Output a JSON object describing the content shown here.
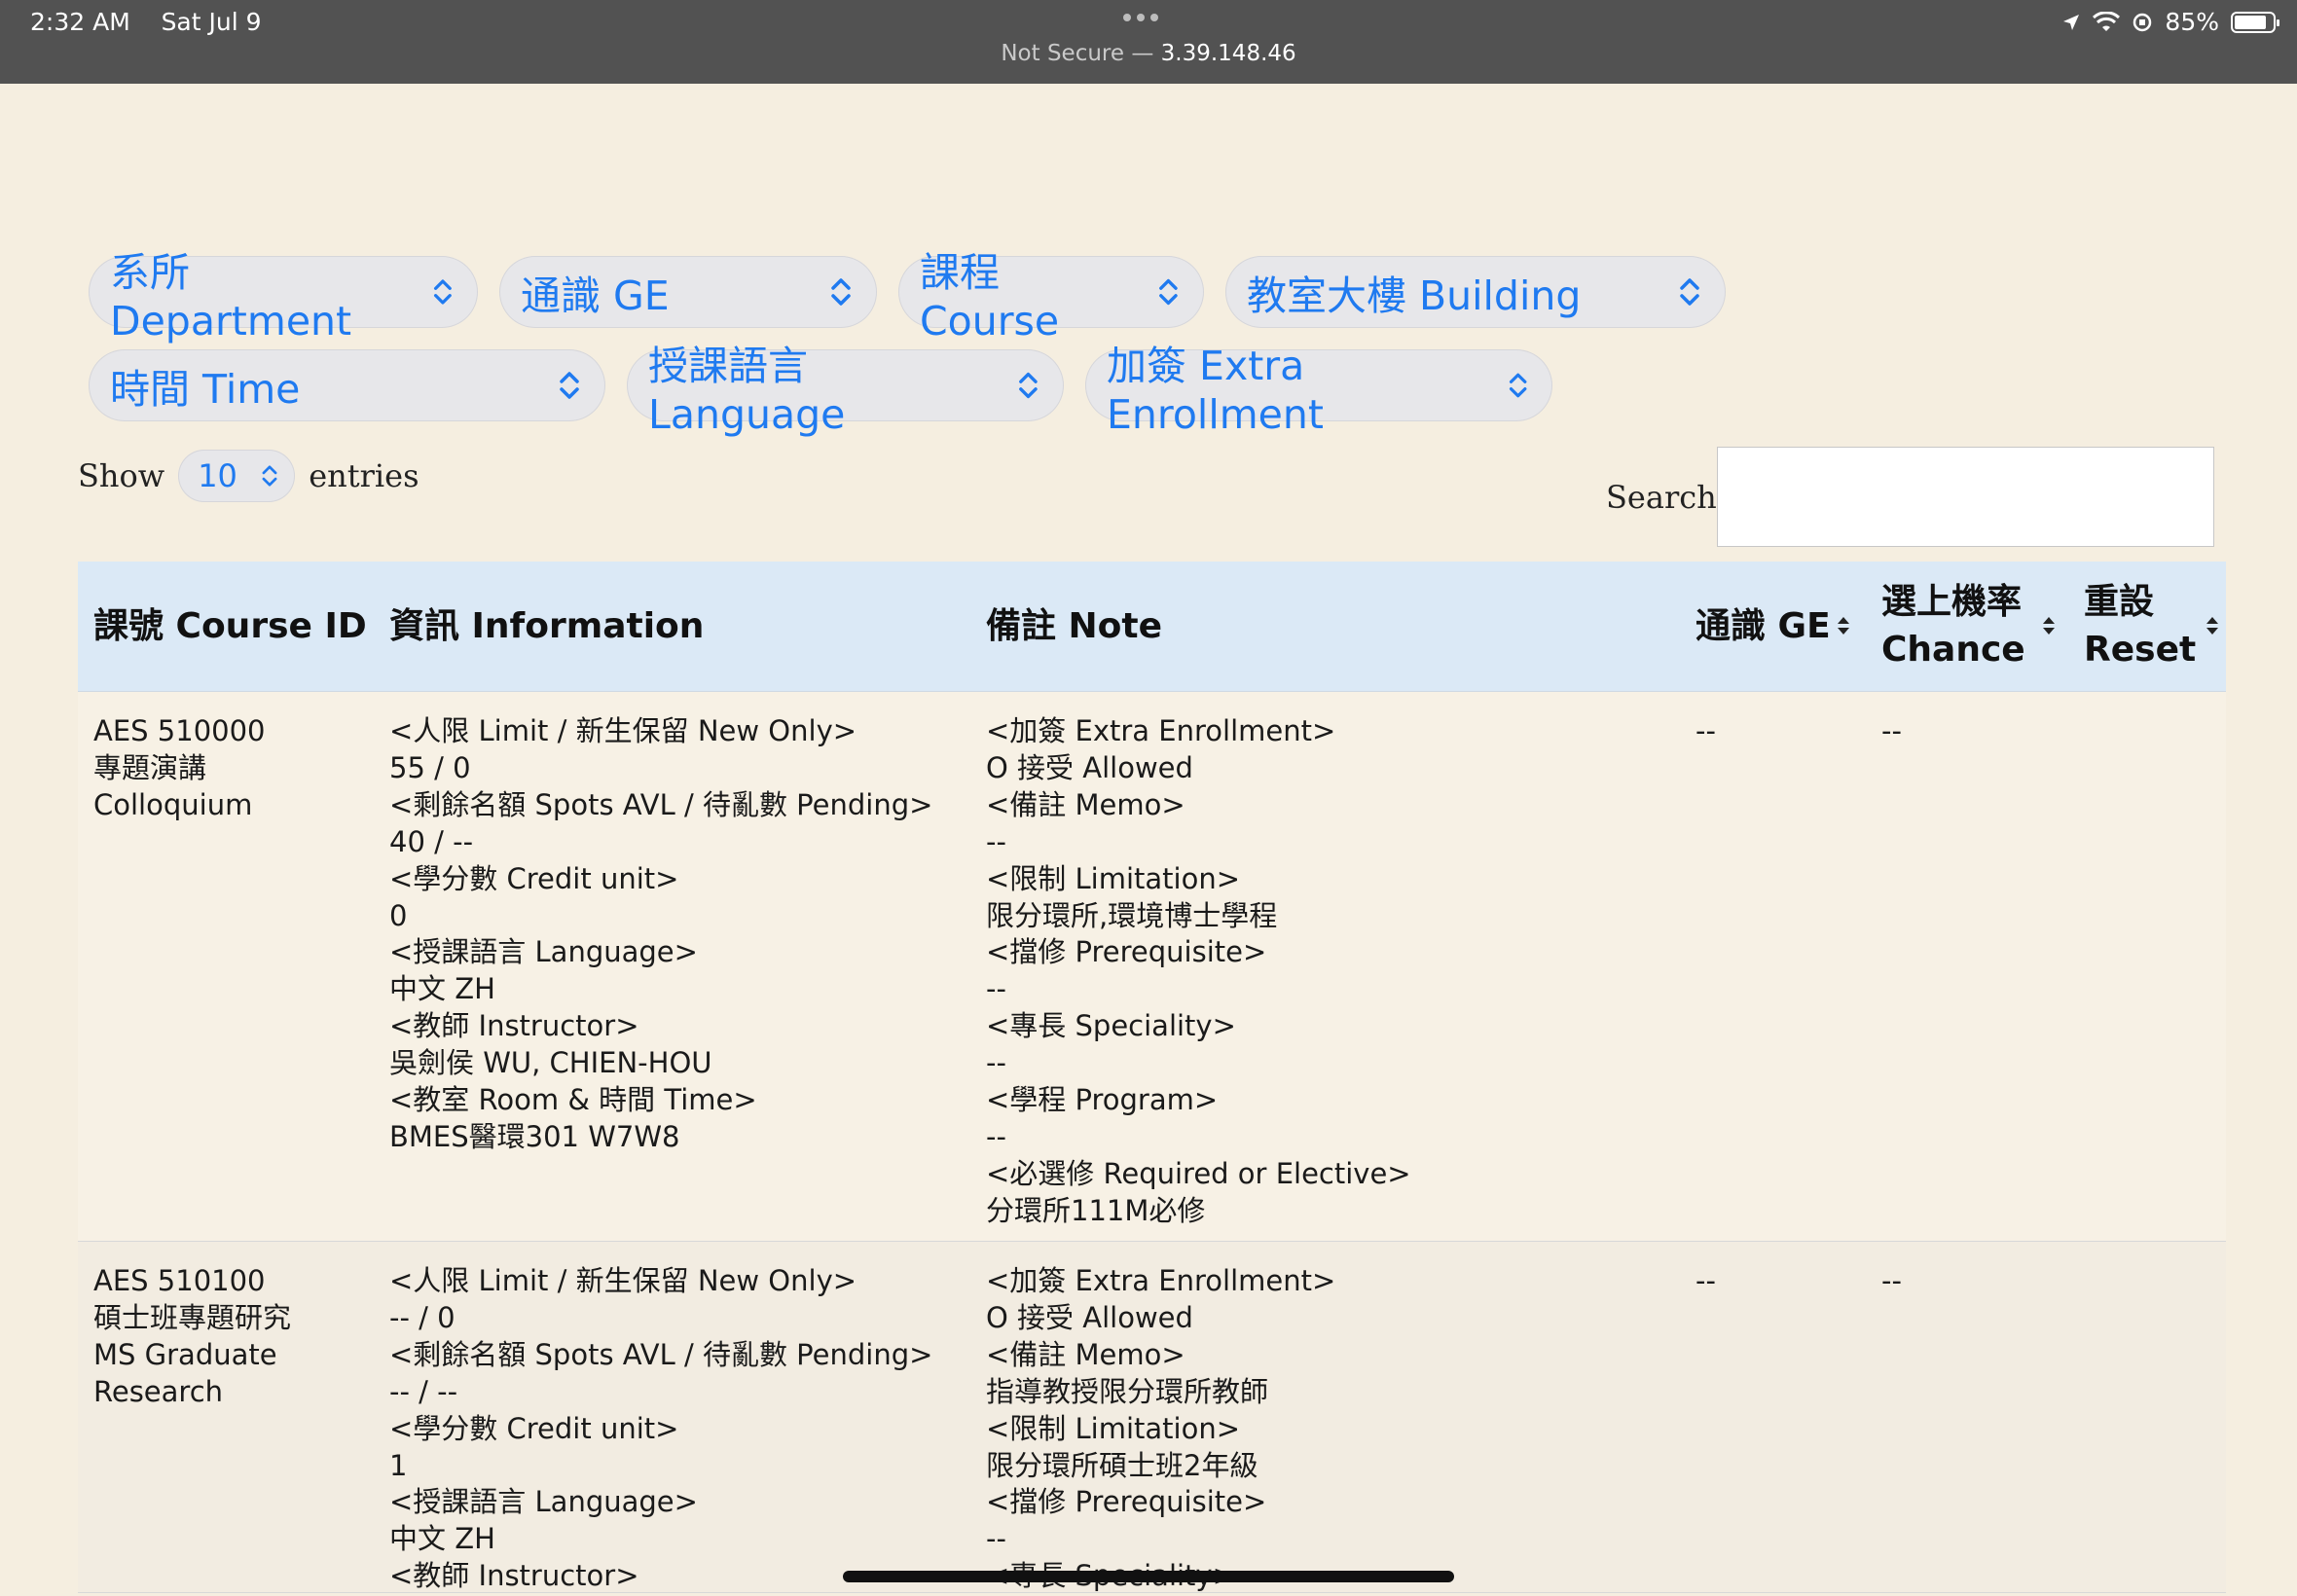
{
  "status_bar": {
    "time": "2:32 AM",
    "date": "Sat Jul 9",
    "security": "Not Secure —",
    "host": "3.39.148.46",
    "battery": "85%",
    "icons": [
      "location-icon",
      "wifi-icon",
      "orientation-lock-icon",
      "battery-icon"
    ]
  },
  "filters": {
    "department": "系所 Department",
    "ge": "通識 GE",
    "course": "課程 Course",
    "building": "教室大樓 Building",
    "time": "時間 Time",
    "language": "授課語言 Language",
    "extra_enrollment": "加簽 Extra Enrollment"
  },
  "length_menu": {
    "show_label": "Show",
    "value": "10",
    "entries_label": "entries"
  },
  "search": {
    "label": "Search:",
    "value": ""
  },
  "table": {
    "headers": {
      "course_id": "課號 Course ID",
      "information": "資訊 Information",
      "note": "備註 Note",
      "ge": "通識 GE",
      "chance_line1": "選上機率",
      "chance_line2": "Chance",
      "reset_line1": "重設",
      "reset_line2": "Reset"
    },
    "rows": [
      {
        "course_id": [
          "AES 510000",
          "專題演講",
          "Colloquium"
        ],
        "information": [
          "<人限 Limit / 新生保留 New Only>",
          "55 / 0",
          "<剩餘名額 Spots AVL / 待亂數 Pending>",
          "40 / --",
          "<學分數 Credit unit>",
          "0",
          "<授課語言 Language>",
          "中文 ZH",
          "<教師 Instructor>",
          "吳劍侯 WU, CHIEN-HOU",
          "<教室 Room & 時間 Time>",
          "BMES醫環301 W7W8"
        ],
        "note": [
          "<加簽 Extra Enrollment>",
          "O 接受 Allowed",
          "<備註 Memo>",
          "--",
          "<限制 Limitation>",
          "限分環所,環境博士學程",
          "<擋修 Prerequisite>",
          "--",
          "<專長 Speciality>",
          "--",
          "<學程 Program>",
          "--",
          "<必選修 Required or Elective>",
          "分環所111M必修"
        ],
        "ge": "--",
        "chance": "--",
        "reset": ""
      },
      {
        "course_id": [
          "AES 510100",
          "碩士班專題研究",
          "MS Graduate",
          "Research"
        ],
        "information": [
          "<人限 Limit / 新生保留 New Only>",
          "-- / 0",
          "<剩餘名額 Spots AVL / 待亂數 Pending>",
          "-- / --",
          "<學分數 Credit unit>",
          "1",
          "<授課語言 Language>",
          "中文 ZH",
          "<教師 Instructor>"
        ],
        "note": [
          "<加簽 Extra Enrollment>",
          "O 接受 Allowed",
          "<備註 Memo>",
          "指導教授限分環所教師",
          "<限制 Limitation>",
          "限分環所碩士班2年級",
          "<擋修 Prerequisite>",
          "--",
          "<專長 Speciality>"
        ],
        "ge": "--",
        "chance": "--",
        "reset": ""
      }
    ]
  }
}
